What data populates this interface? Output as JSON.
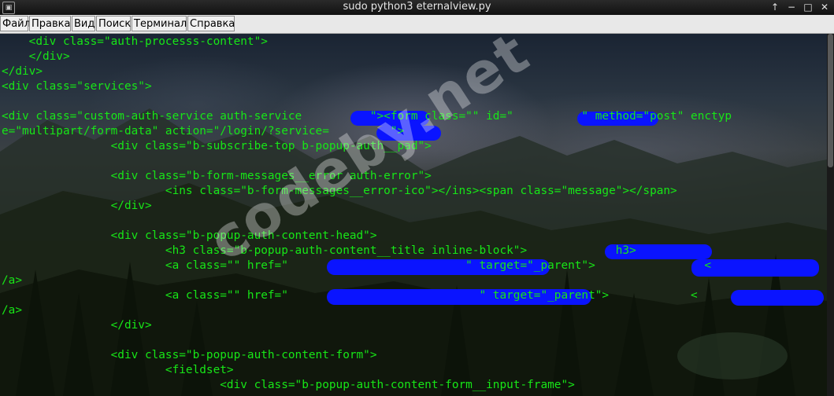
{
  "window": {
    "title": "sudo python3 eternalview.py",
    "controls": {
      "up": "↑",
      "minimize": "−",
      "maximize": "□",
      "close": "✕"
    }
  },
  "menu": [
    "Файл",
    "Правка",
    "Вид",
    "Поиск",
    "Терминал",
    "Справка"
  ],
  "terminal": {
    "lines": [
      "    <div class=\"auth-processs-content\">",
      "    </div>",
      "</div>",
      "<div class=\"services\">",
      "",
      "<div class=\"custom-auth-service auth-service          \"><form class=\"\" id=\"          \" method=\"post\" enctyp",
      "e=\"multipart/form-data\" action=\"/login/?service=         \">",
      "                <div class=\"b-subscribe-top b-popup-auth__pad\">",
      "",
      "                <div class=\"b-form-messages__error auth-error\">",
      "                        <ins class=\"b-form-messages__error-ico\"></ins><span class=\"message\"></span>",
      "                </div>",
      "",
      "                <div class=\"b-popup-auth-content-head\">",
      "                        <h3 class=\"b-popup-auth-content__title inline-block\">             h3>",
      "                        <a class=\"\" href=\"                          \" target=\"_parent\">                <",
      "/a>",
      "                        <a class=\"\" href=\"                            \" target=\"_parent\">            <",
      "/a>",
      "                </div>",
      "",
      "                <div class=\"b-popup-auth-content-form\">",
      "                        <fieldset>",
      "                                <div class=\"b-popup-auth-content-form__input-frame\">"
    ]
  },
  "watermark": "codeby.net",
  "colors": {
    "terminal_text": "#17e617",
    "redaction": "#0a14ff"
  }
}
